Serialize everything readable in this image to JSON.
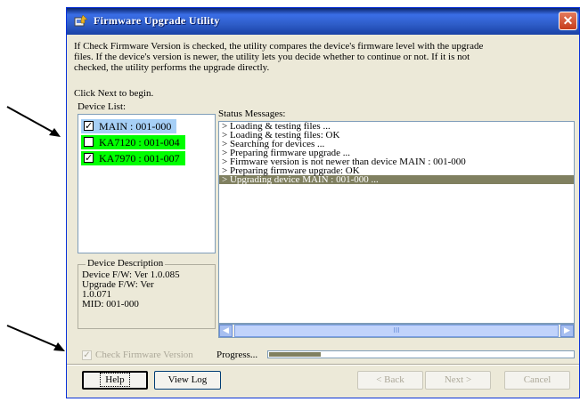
{
  "window": {
    "title": "Firmware Upgrade Utility",
    "close_glyph": "✕"
  },
  "intro": {
    "line1": "If Check Firmware Version is checked, the utility compares the device's firmware level with the upgrade",
    "line2": "files. If the device's version is newer, the utility lets you decide whether to continue or not. If it is not",
    "line3": "checked, the utility performs the upgrade directly.",
    "click_next": "Click Next to begin."
  },
  "device_list": {
    "label": "Device List:",
    "items": [
      {
        "label": "MAIN : 001-000",
        "checked": true,
        "state": "selected"
      },
      {
        "label": "KA7120 : 001-004",
        "checked": false,
        "state": "green"
      },
      {
        "label": "KA7970 : 001-007",
        "checked": true,
        "state": "green"
      }
    ]
  },
  "device_description": {
    "title": "Device Description",
    "line1": "Device F/W: Ver 1.0.085",
    "line2": "Upgrade F/W: Ver",
    "line3": "1.0.071",
    "line4": "MID: 001-000"
  },
  "status": {
    "label": "Status Messages:",
    "messages": [
      "> Loading & testing files ...",
      "> Loading & testing files: OK",
      "> Searching for devices ...",
      "> Preparing firmware upgrade ...",
      "> Firmware version is not newer than device MAIN : 001-000",
      "> Preparing firmware upgrade: OK",
      "> Upgrading device MAIN : 001-000 ..."
    ],
    "highlighted_index": 6
  },
  "scrollbar": {
    "left_arrow": "◀",
    "right_arrow": "▶",
    "grip": "III"
  },
  "check_firmware": {
    "label": "Check Firmware Version",
    "checked": true,
    "enabled": false,
    "check_glyph": "✓"
  },
  "progress": {
    "label": "Progress...",
    "fraction": 0.17
  },
  "buttons": {
    "help": "Help",
    "view_log": "View Log",
    "back": "< Back",
    "next": "Next >",
    "cancel": "Cancel"
  },
  "colors": {
    "title_bar": "#2f5ec9",
    "selected_item": "#a6cff6",
    "green_item": "#00ff00",
    "highlight": "#808060"
  },
  "icons": {
    "app": "upgrade-app-icon",
    "pointer_arrows": "arrow-pointer-icon"
  }
}
